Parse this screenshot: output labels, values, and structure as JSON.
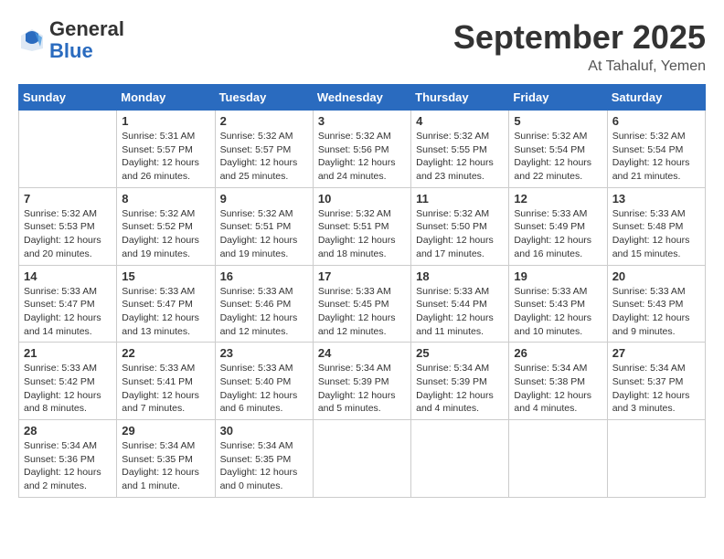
{
  "header": {
    "logo": {
      "general": "General",
      "blue": "Blue"
    },
    "title": "September 2025",
    "subtitle": "At Tahaluf, Yemen"
  },
  "weekdays": [
    "Sunday",
    "Monday",
    "Tuesday",
    "Wednesday",
    "Thursday",
    "Friday",
    "Saturday"
  ],
  "weeks": [
    [
      {
        "date": "",
        "info": ""
      },
      {
        "date": "1",
        "info": "Sunrise: 5:31 AM\nSunset: 5:57 PM\nDaylight: 12 hours\nand 26 minutes."
      },
      {
        "date": "2",
        "info": "Sunrise: 5:32 AM\nSunset: 5:57 PM\nDaylight: 12 hours\nand 25 minutes."
      },
      {
        "date": "3",
        "info": "Sunrise: 5:32 AM\nSunset: 5:56 PM\nDaylight: 12 hours\nand 24 minutes."
      },
      {
        "date": "4",
        "info": "Sunrise: 5:32 AM\nSunset: 5:55 PM\nDaylight: 12 hours\nand 23 minutes."
      },
      {
        "date": "5",
        "info": "Sunrise: 5:32 AM\nSunset: 5:54 PM\nDaylight: 12 hours\nand 22 minutes."
      },
      {
        "date": "6",
        "info": "Sunrise: 5:32 AM\nSunset: 5:54 PM\nDaylight: 12 hours\nand 21 minutes."
      }
    ],
    [
      {
        "date": "7",
        "info": "Sunrise: 5:32 AM\nSunset: 5:53 PM\nDaylight: 12 hours\nand 20 minutes."
      },
      {
        "date": "8",
        "info": "Sunrise: 5:32 AM\nSunset: 5:52 PM\nDaylight: 12 hours\nand 19 minutes."
      },
      {
        "date": "9",
        "info": "Sunrise: 5:32 AM\nSunset: 5:51 PM\nDaylight: 12 hours\nand 19 minutes."
      },
      {
        "date": "10",
        "info": "Sunrise: 5:32 AM\nSunset: 5:51 PM\nDaylight: 12 hours\nand 18 minutes."
      },
      {
        "date": "11",
        "info": "Sunrise: 5:32 AM\nSunset: 5:50 PM\nDaylight: 12 hours\nand 17 minutes."
      },
      {
        "date": "12",
        "info": "Sunrise: 5:33 AM\nSunset: 5:49 PM\nDaylight: 12 hours\nand 16 minutes."
      },
      {
        "date": "13",
        "info": "Sunrise: 5:33 AM\nSunset: 5:48 PM\nDaylight: 12 hours\nand 15 minutes."
      }
    ],
    [
      {
        "date": "14",
        "info": "Sunrise: 5:33 AM\nSunset: 5:47 PM\nDaylight: 12 hours\nand 14 minutes."
      },
      {
        "date": "15",
        "info": "Sunrise: 5:33 AM\nSunset: 5:47 PM\nDaylight: 12 hours\nand 13 minutes."
      },
      {
        "date": "16",
        "info": "Sunrise: 5:33 AM\nSunset: 5:46 PM\nDaylight: 12 hours\nand 12 minutes."
      },
      {
        "date": "17",
        "info": "Sunrise: 5:33 AM\nSunset: 5:45 PM\nDaylight: 12 hours\nand 12 minutes."
      },
      {
        "date": "18",
        "info": "Sunrise: 5:33 AM\nSunset: 5:44 PM\nDaylight: 12 hours\nand 11 minutes."
      },
      {
        "date": "19",
        "info": "Sunrise: 5:33 AM\nSunset: 5:43 PM\nDaylight: 12 hours\nand 10 minutes."
      },
      {
        "date": "20",
        "info": "Sunrise: 5:33 AM\nSunset: 5:43 PM\nDaylight: 12 hours\nand 9 minutes."
      }
    ],
    [
      {
        "date": "21",
        "info": "Sunrise: 5:33 AM\nSunset: 5:42 PM\nDaylight: 12 hours\nand 8 minutes."
      },
      {
        "date": "22",
        "info": "Sunrise: 5:33 AM\nSunset: 5:41 PM\nDaylight: 12 hours\nand 7 minutes."
      },
      {
        "date": "23",
        "info": "Sunrise: 5:33 AM\nSunset: 5:40 PM\nDaylight: 12 hours\nand 6 minutes."
      },
      {
        "date": "24",
        "info": "Sunrise: 5:34 AM\nSunset: 5:39 PM\nDaylight: 12 hours\nand 5 minutes."
      },
      {
        "date": "25",
        "info": "Sunrise: 5:34 AM\nSunset: 5:39 PM\nDaylight: 12 hours\nand 4 minutes."
      },
      {
        "date": "26",
        "info": "Sunrise: 5:34 AM\nSunset: 5:38 PM\nDaylight: 12 hours\nand 4 minutes."
      },
      {
        "date": "27",
        "info": "Sunrise: 5:34 AM\nSunset: 5:37 PM\nDaylight: 12 hours\nand 3 minutes."
      }
    ],
    [
      {
        "date": "28",
        "info": "Sunrise: 5:34 AM\nSunset: 5:36 PM\nDaylight: 12 hours\nand 2 minutes."
      },
      {
        "date": "29",
        "info": "Sunrise: 5:34 AM\nSunset: 5:35 PM\nDaylight: 12 hours\nand 1 minute."
      },
      {
        "date": "30",
        "info": "Sunrise: 5:34 AM\nSunset: 5:35 PM\nDaylight: 12 hours\nand 0 minutes."
      },
      {
        "date": "",
        "info": ""
      },
      {
        "date": "",
        "info": ""
      },
      {
        "date": "",
        "info": ""
      },
      {
        "date": "",
        "info": ""
      }
    ]
  ]
}
